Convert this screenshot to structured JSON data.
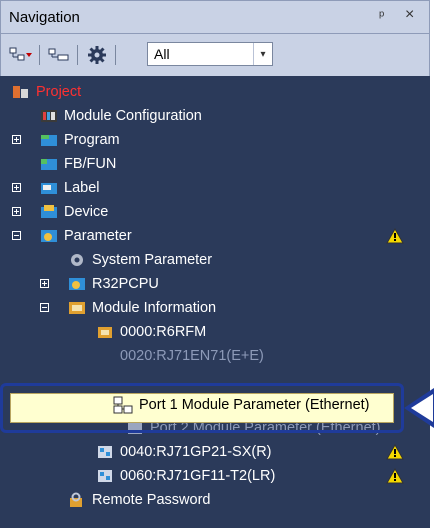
{
  "window": {
    "title": "Navigation",
    "pin_glyph": "ᵖ",
    "close_glyph": "×"
  },
  "toolbar": {
    "filter_value": "All",
    "filter_arrow": "▾"
  },
  "tree": {
    "project": "Project",
    "module_configuration": "Module Configuration",
    "program": "Program",
    "fbfun": "FB/FUN",
    "label": "Label",
    "device": "Device",
    "parameter": "Parameter",
    "system_parameter": "System Parameter",
    "r32pcpu": "R32PCPU",
    "module_information": "Module Information",
    "r6rfm": "0000:R6RFM",
    "rj71en71_partial": "0020:RJ71EN71(E+E)",
    "port1": "Port 1 Module Parameter (Ethernet)",
    "port2": "Port 2 Module Parameter (Ethernet)",
    "rj71gp21": "0040:RJ71GP21-SX(R)",
    "rj71gf11": "0060:RJ71GF11-T2(LR)",
    "remote_password": "Remote Password"
  },
  "colors": {
    "panel_bg": "#2b3a5a",
    "project_red": "#ff3030",
    "highlight_bg": "#ffffd0",
    "callout_blue": "#1f3b9a"
  }
}
